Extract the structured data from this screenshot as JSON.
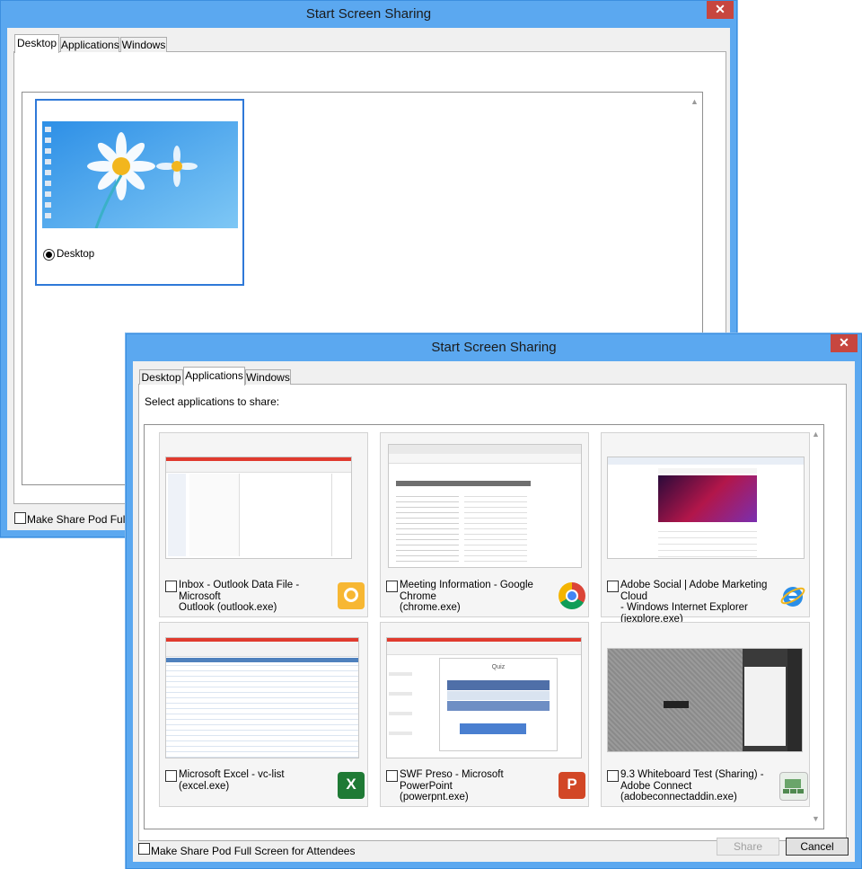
{
  "back_window": {
    "title": "Start Screen Sharing",
    "close_glyph": "✕",
    "tabs": [
      "Desktop",
      "Applications",
      "Windows"
    ],
    "active_tab": "Desktop",
    "desktop_option_label": "Desktop",
    "footer_checkbox_label": "Make Share Pod Full Scr"
  },
  "front_window": {
    "title": "Start Screen Sharing",
    "close_glyph": "✕",
    "tabs": [
      "Desktop",
      "Applications",
      "Windows"
    ],
    "active_tab": "Applications",
    "instruction": "Select applications to share:",
    "apps": [
      {
        "line1": "Inbox - Outlook Data File - Microsoft",
        "line2": "Outlook (outlook.exe)",
        "line3": "",
        "icon": "outlook-icon",
        "icon_color": "#f3a11b"
      },
      {
        "line1": "Meeting Information - Google Chrome",
        "line2": "(chrome.exe)",
        "line3": "",
        "icon": "chrome-icon",
        "icon_color": "#db4437"
      },
      {
        "line1": "Adobe Social | Adobe Marketing Cloud",
        "line2": "- Windows Internet Explorer",
        "line3": "(iexplore.exe)",
        "icon": "internet-explorer-icon",
        "icon_color": "#1e88e5"
      },
      {
        "line1": "Microsoft Excel - vc-list (excel.exe)",
        "line2": "",
        "line3": "",
        "icon": "excel-icon",
        "icon_color": "#1f7a35"
      },
      {
        "line1": "SWF Preso - Microsoft PowerPoint",
        "line2": "(powerpnt.exe)",
        "line3": "",
        "icon": "powerpoint-icon",
        "icon_color": "#d24726"
      },
      {
        "line1": "9.3 Whiteboard Test (Sharing) -",
        "line2": "Adobe Connect",
        "line3": "(adobeconnectaddin.exe)",
        "icon": "adobe-connect-icon",
        "icon_color": "#5a9a5a"
      }
    ],
    "thumb_quiz_title": "Quiz",
    "footer_checkbox_label": "Make Share Pod Full Screen for Attendees",
    "share_button": "Share",
    "cancel_button": "Cancel"
  }
}
